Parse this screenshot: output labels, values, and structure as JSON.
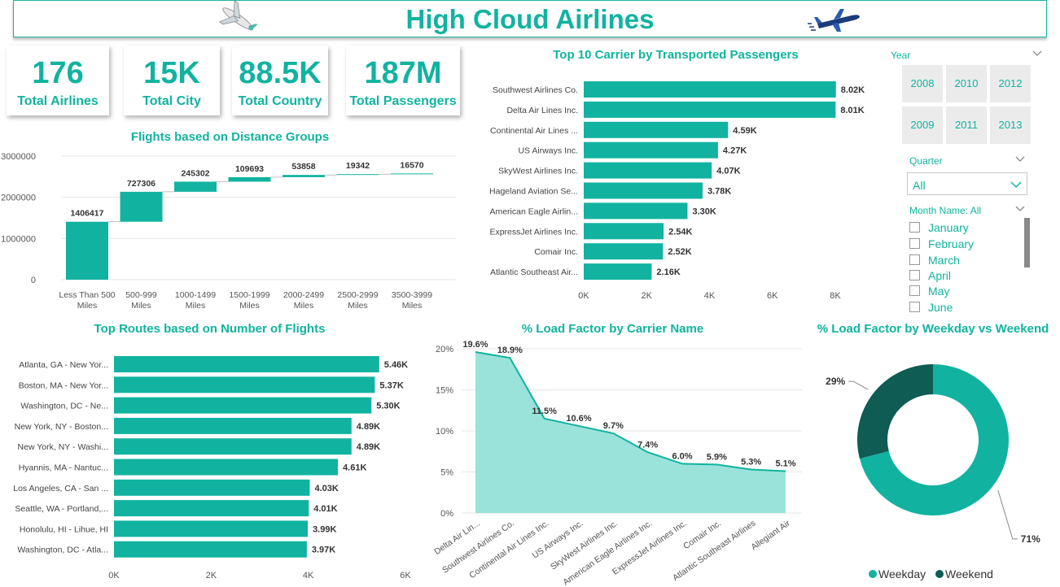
{
  "title": "High Cloud Airlines",
  "kpis": [
    {
      "value": "176",
      "label": "Total Airlines"
    },
    {
      "value": "15K",
      "label": "Total City"
    },
    {
      "value": "88.5K",
      "label": "Total Country"
    },
    {
      "value": "187M",
      "label": "Total Passengers"
    }
  ],
  "slicers": {
    "year_label": "Year",
    "years": [
      "2008",
      "2010",
      "2012",
      "2009",
      "2011",
      "2013"
    ],
    "quarter_label": "Quarter",
    "quarter_value": "All",
    "month_label": "Month Name: All",
    "months": [
      "January",
      "February",
      "March",
      "April",
      "May",
      "June"
    ]
  },
  "colors": {
    "teal": "#11b3a0",
    "dark_teal": "#0e5c53",
    "area": "#9ae3da"
  },
  "chart_data": [
    {
      "type": "bar",
      "orientation": "waterfall",
      "title": "Flights based on Distance Groups",
      "categories": [
        "Less Than 500 Miles",
        "500-999 Miles",
        "1000-1499 Miles",
        "1500-1999 Miles",
        "2000-2499 Miles",
        "2500-2999 Miles",
        "3500-3999 Miles"
      ],
      "values": [
        1406417,
        727306,
        245302,
        109693,
        53858,
        19342,
        16570
      ],
      "value_labels": [
        "1406417",
        "727306",
        "245302",
        "109693",
        "53858",
        "19342",
        "16570"
      ],
      "y_ticks": [
        "0",
        "1000000",
        "2000000",
        "3000000"
      ],
      "ylim": [
        0,
        3000000
      ],
      "grid": true
    },
    {
      "type": "bar",
      "orientation": "horizontal",
      "title": "Top 10 Carrier by Transported Passengers",
      "categories": [
        "Southwest Airlines Co.",
        "Delta Air Lines Inc.",
        "Continental Air Lines ...",
        "US Airways Inc.",
        "SkyWest Airlines Inc.",
        "Hageland Aviation Se...",
        "American Eagle Airlin...",
        "ExpressJet Airlines Inc.",
        "Comair Inc.",
        "Atlantic Southeast Air..."
      ],
      "values": [
        8020,
        8010,
        4590,
        4270,
        4070,
        3780,
        3300,
        2540,
        2520,
        2160
      ],
      "value_labels": [
        "8.02K",
        "8.01K",
        "4.59K",
        "4.27K",
        "4.07K",
        "3.78K",
        "3.30K",
        "2.54K",
        "2.52K",
        "2.16K"
      ],
      "x_ticks": [
        "0K",
        "2K",
        "4K",
        "6K",
        "8K"
      ],
      "xlim": [
        0,
        8000
      ]
    },
    {
      "type": "bar",
      "orientation": "horizontal",
      "title": "Top Routes based on Number of Flights",
      "categories": [
        "Atlanta, GA - New Yor...",
        "Boston, MA - New Yor...",
        "Washington, DC - Ne...",
        "New York, NY - Boston...",
        "New York, NY - Washi...",
        "Hyannis, MA - Nantuc...",
        "Los Angeles, CA - San ...",
        "Seattle, WA - Portland,...",
        "Honolulu, HI - Lihue, HI",
        "Washington, DC - Atla..."
      ],
      "values": [
        5460,
        5370,
        5300,
        4890,
        4890,
        4610,
        4030,
        4010,
        3990,
        3970
      ],
      "value_labels": [
        "5.46K",
        "5.37K",
        "5.30K",
        "4.89K",
        "4.89K",
        "4.61K",
        "4.03K",
        "4.01K",
        "3.99K",
        "3.97K"
      ],
      "x_ticks": [
        "0K",
        "2K",
        "4K",
        "6K"
      ],
      "xlim": [
        0,
        6000
      ]
    },
    {
      "type": "area",
      "title": "% Load Factor by Carrier Name",
      "categories": [
        "Delta Air Lin...",
        "Southwest Airlines Co.",
        "Continental Air Lines Inc.",
        "US Airways Inc.",
        "SkyWest Airlines Inc.",
        "American Eagle Airlines Inc.",
        "ExpressJet Airlines Inc.",
        "Comair Inc.",
        "Atlantic Southeast Airlines",
        "Allegiant Air"
      ],
      "values": [
        19.6,
        18.9,
        11.5,
        10.6,
        9.7,
        7.4,
        6.0,
        5.9,
        5.3,
        5.1
      ],
      "value_labels": [
        "19.6%",
        "18.9%",
        "11.5%",
        "10.6%",
        "9.7%",
        "7.4%",
        "6.0%",
        "5.9%",
        "5.3%",
        "5.1%"
      ],
      "y_ticks": [
        "0%",
        "5%",
        "10%",
        "15%",
        "20%"
      ],
      "ylim": [
        0,
        20
      ],
      "grid": true
    },
    {
      "type": "pie",
      "variant": "donut",
      "title": "% Load Factor by Weekday vs Weekend",
      "labels": [
        "Weekday",
        "Weekend"
      ],
      "values": [
        71,
        29
      ],
      "value_labels": [
        "71%",
        "29%"
      ],
      "legend": "bottom"
    }
  ]
}
